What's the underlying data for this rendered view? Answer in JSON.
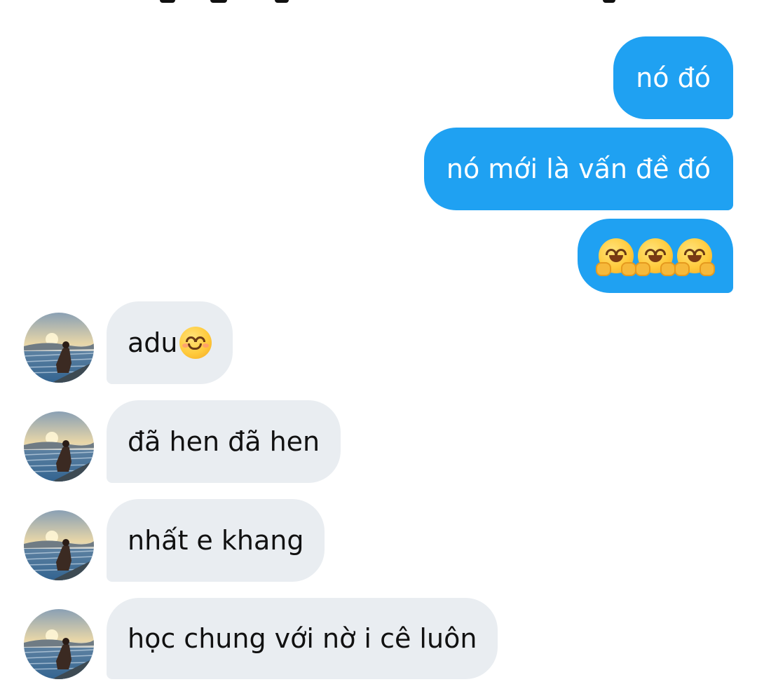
{
  "conversation": {
    "outgoing": [
      {
        "text": "nó đó"
      },
      {
        "text": "nó mới là vấn đề đó"
      },
      {
        "emojis": [
          "hugging-face-icon",
          "hugging-face-icon",
          "hugging-face-icon"
        ]
      }
    ],
    "incoming": [
      {
        "text": "adu",
        "emoji": "smiling-face-icon"
      },
      {
        "text": "đã hen đã hen"
      },
      {
        "text": "nhất e khang"
      },
      {
        "text": "học chung với nờ i cê luôn"
      }
    ]
  },
  "colors": {
    "outgoing_bubble": "#1fa1f2",
    "incoming_bubble": "#e9edf1",
    "outgoing_text": "#ffffff",
    "incoming_text": "#111111"
  }
}
